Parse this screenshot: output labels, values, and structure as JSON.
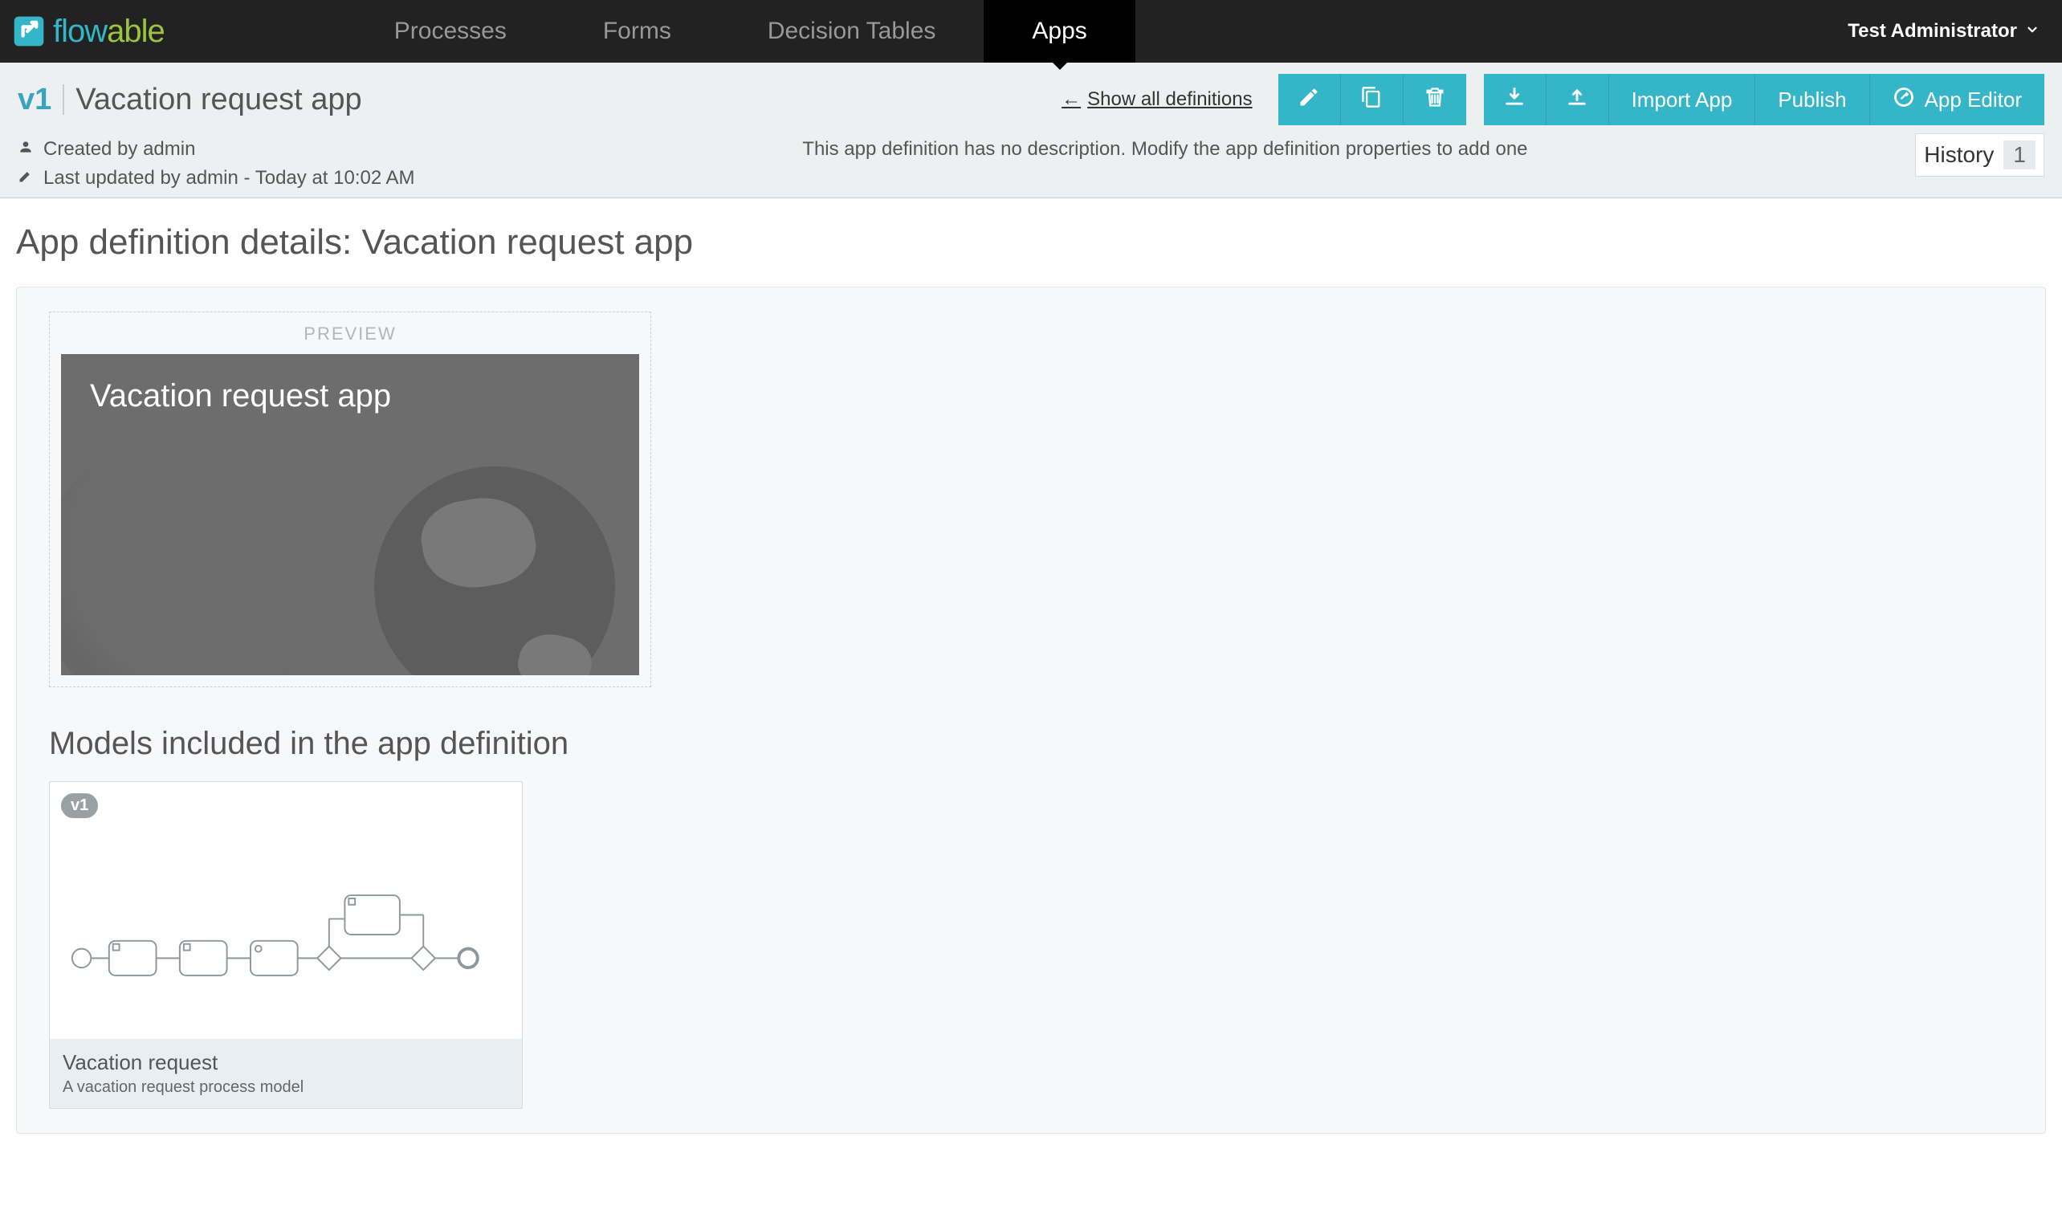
{
  "nav": {
    "tabs": [
      "Processes",
      "Forms",
      "Decision Tables",
      "Apps"
    ],
    "active_index": 3,
    "user": "Test Administrator"
  },
  "header": {
    "version": "v1",
    "app_title": "Vacation request app",
    "show_all": "Show all definitions",
    "buttons": {
      "import_app": "Import App",
      "publish": "Publish",
      "app_editor": "App Editor"
    },
    "meta": {
      "created_by": "Created by admin",
      "last_updated": "Last updated by admin - Today at 10:02 AM"
    },
    "description_note": "This app definition has no description. Modify the app definition properties to add one",
    "history_label": "History",
    "history_count": "1"
  },
  "main": {
    "page_heading": "App definition details: Vacation request app",
    "preview_label": "PREVIEW",
    "tile_title": "Vacation request app",
    "models_heading": "Models included in the app definition",
    "model": {
      "version_badge": "v1",
      "name": "Vacation request",
      "description": "A vacation request process model"
    }
  }
}
